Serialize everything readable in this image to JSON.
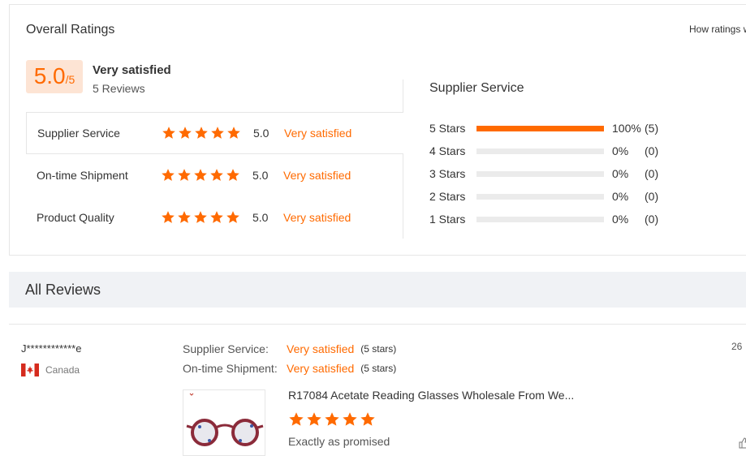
{
  "overall": {
    "title": "Overall Ratings",
    "how_link": "How ratings w",
    "score": "5.0",
    "score_max": "/5",
    "score_label": "Very satisfied",
    "review_count": "5 Reviews"
  },
  "categories": [
    {
      "name": "Supplier Service",
      "stars": 5,
      "value": "5.0",
      "desc": "Very satisfied"
    },
    {
      "name": "On-time Shipment",
      "stars": 5,
      "value": "5.0",
      "desc": "Very satisfied"
    },
    {
      "name": "Product Quality",
      "stars": 5,
      "value": "5.0",
      "desc": "Very satisfied"
    }
  ],
  "distribution": {
    "title": "Supplier Service",
    "rows": [
      {
        "label": "5  Stars",
        "fraction": 1.0,
        "pct": "100%",
        "count": "(5)"
      },
      {
        "label": "4  Stars",
        "fraction": 0.0,
        "pct": "0%",
        "count": "(0)"
      },
      {
        "label": "3  Stars",
        "fraction": 0.0,
        "pct": "0%",
        "count": "(0)"
      },
      {
        "label": "2  Stars",
        "fraction": 0.0,
        "pct": "0%",
        "count": "(0)"
      },
      {
        "label": "1  Stars",
        "fraction": 0.0,
        "pct": "0%",
        "count": "(0)"
      }
    ]
  },
  "all_reviews": {
    "title": "All Reviews"
  },
  "review": {
    "reviewer": "J************e",
    "country": "Canada",
    "date": "26",
    "lines": [
      {
        "key": "Supplier Service:",
        "value": "Very satisfied",
        "stars": "(5 stars)"
      },
      {
        "key": "On-time Shipment:",
        "value": "Very satisfied",
        "stars": "(5 stars)"
      }
    ],
    "product_name": "R17084 Acetate Reading Glasses Wholesale From We...",
    "product_stars": 5,
    "text": "Exactly as promised"
  },
  "colors": {
    "accent": "#ff6a00",
    "badge_bg": "#fde4d4",
    "track": "#ebebeb"
  }
}
